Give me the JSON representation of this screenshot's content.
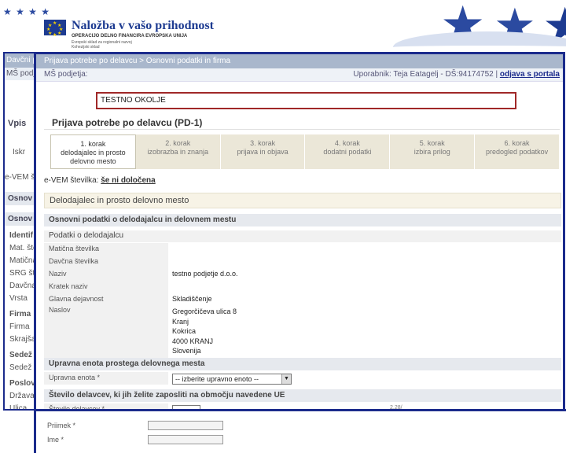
{
  "banner": {
    "slogan": "Naložba v vašo prihodnost",
    "program": "OPERACIJO DELNO FINANCIRA EVROPSKA UNIJA",
    "fund1": "Evropski sklad za regionalni razvoj",
    "fund2": "Kohezijski sklad",
    "flag_color": "#1d3b91",
    "star_color": "#f4d000"
  },
  "background_window": {
    "title": "Davčni p",
    "subtitle": "MŠ podje",
    "left_rows": [
      "Vpis",
      "Iskr",
      "e-VEM š",
      "Osnov",
      "Osnov",
      "Identif",
      "Mat. šte",
      "Matična",
      "SRG št.",
      "Davčna",
      "Vrsta",
      "Firma",
      "Firma",
      "Skrajša",
      "Sedež",
      "Sedež",
      "Poslovn",
      "Država",
      "Ulica"
    ]
  },
  "main_window": {
    "breadcrumb": "Prijava potrebe po delavcu > Osnovni podatki in firma",
    "user_left": "MŠ podjetja:",
    "user_right": "Uporabnik: Teja Eatagelj - DŠ:94174752 |",
    "logout": "odjava s portala",
    "test_notice": "TESTNO OKOLJE",
    "form_title": "Prijava potrebe po delavcu (PD-1)",
    "steps": [
      {
        "l1": "1. korak",
        "l2": "delodajalec in prosto",
        "l3": "delovno mesto",
        "active": true
      },
      {
        "l1": "2. korak",
        "l2": "izobrazba in znanja",
        "l3": "",
        "active": false
      },
      {
        "l1": "3. korak",
        "l2": "prijava in objava",
        "l3": "",
        "active": false
      },
      {
        "l1": "4. korak",
        "l2": "dodatni podatki",
        "l3": "",
        "active": false
      },
      {
        "l1": "5. korak",
        "l2": "izbira prilog",
        "l3": "",
        "active": false
      },
      {
        "l1": "6. korak",
        "l2": "predogled podatkov",
        "l3": "",
        "active": false
      }
    ],
    "evem_label": "e-VEM številka:",
    "evem_value": "še ni določena",
    "section_title": "Delodajalec in prosto delovno mesto",
    "subsection_title": "Osnovni podatki o delodajalcu in delovnem mestu",
    "panel_employer": "Podatki o delodajalcu",
    "fields": [
      {
        "label": "Matična številka",
        "value": ""
      },
      {
        "label": "Davčna številka",
        "value": ""
      },
      {
        "label": "Naziv",
        "value": "testno podjetje d.o.o."
      },
      {
        "label": "Kratek naziv",
        "value": ""
      },
      {
        "label": "Glavna dejavnost",
        "value": "Skladiščenje"
      }
    ],
    "address_label": "Naslov",
    "address_lines": [
      "Gregorčičeva ulica 8",
      "Kranj",
      "Kokrica",
      "4000 KRANJ",
      "Slovenija"
    ],
    "panel_unit": "Upravna enota prostega delovnega mesta",
    "unit_label": "Upravna enota *",
    "unit_select": "-- izberite upravno enoto --",
    "panel_workers": "Število delavcev, ki jih želite zaposliti na območju navedene UE",
    "workers_label": "Število delavcev *"
  },
  "lower_overlay": {
    "label1": "Priimek *",
    "label2": "Ime *",
    "misc": "2.28/"
  }
}
